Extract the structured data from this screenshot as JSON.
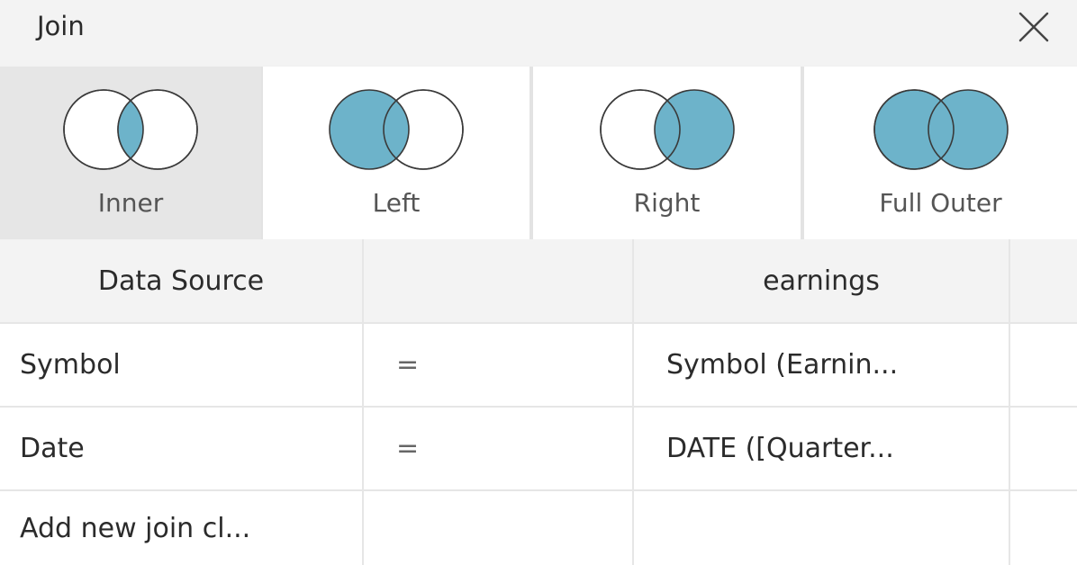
{
  "dialog": {
    "title": "Join"
  },
  "join_types": [
    {
      "label": "Inner",
      "selected": true,
      "icon": "venn-inner-icon"
    },
    {
      "label": "Left",
      "selected": false,
      "icon": "venn-left-icon"
    },
    {
      "label": "Right",
      "selected": false,
      "icon": "venn-right-icon"
    },
    {
      "label": "Full Outer",
      "selected": false,
      "icon": "venn-full-outer-icon"
    }
  ],
  "clauses": {
    "header": {
      "left_source": "Data Source",
      "operator": "",
      "right_source": "earnings"
    },
    "rows": [
      {
        "left": "Symbol",
        "operator": "=",
        "right": "Symbol (Earnin..."
      },
      {
        "left": "Date",
        "operator": "=",
        "right": "DATE ([Quarter..."
      }
    ],
    "add_new": "Add new join cl..."
  },
  "colors": {
    "venn_fill": "#6db3ca",
    "venn_stroke": "#3a3a3a",
    "selected_bg": "#e6e6e6",
    "header_bg": "#f3f3f3"
  }
}
